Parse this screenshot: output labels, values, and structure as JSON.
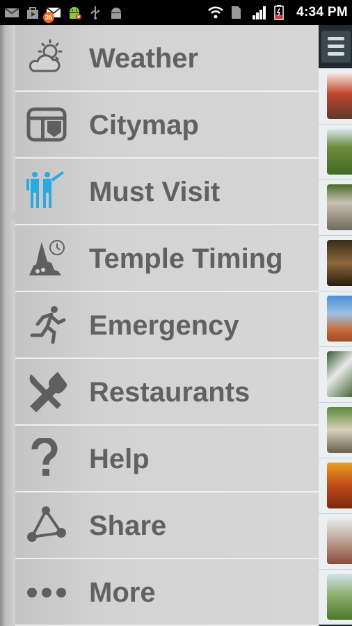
{
  "status_bar": {
    "time": "4:34 PM",
    "badge_count": "35",
    "left_icons": [
      "gmail-icon",
      "bag-icon",
      "mail-icon",
      "android-icon",
      "usb-icon",
      "android-debug-icon"
    ],
    "right_icons": [
      "wifi-icon",
      "sim-icon",
      "signal-icon",
      "battery-icon"
    ]
  },
  "menu": {
    "items": [
      {
        "label": "Weather",
        "icon": "weather-icon"
      },
      {
        "label": "Citymap",
        "icon": "citymap-icon"
      },
      {
        "label": "Must Visit",
        "icon": "must-visit-icon",
        "active": true,
        "accent": "#29abe2"
      },
      {
        "label": "Temple Timing",
        "icon": "temple-timing-icon"
      },
      {
        "label": "Emergency",
        "icon": "emergency-icon"
      },
      {
        "label": "Restaurants",
        "icon": "restaurants-icon"
      },
      {
        "label": "Help",
        "icon": "help-icon"
      },
      {
        "label": "Share",
        "icon": "share-icon"
      },
      {
        "label": "More",
        "icon": "more-icon"
      }
    ]
  },
  "colors": {
    "menu_text": "#616161",
    "icon": "#5f5f5f",
    "active_icon": "#29abe2",
    "menu_bg": "#d3d3d3",
    "right_panel": "#1e2a2e"
  },
  "right_panel": {
    "menu_button_icon": "hamburger-icon",
    "thumbnail_count": 10
  }
}
